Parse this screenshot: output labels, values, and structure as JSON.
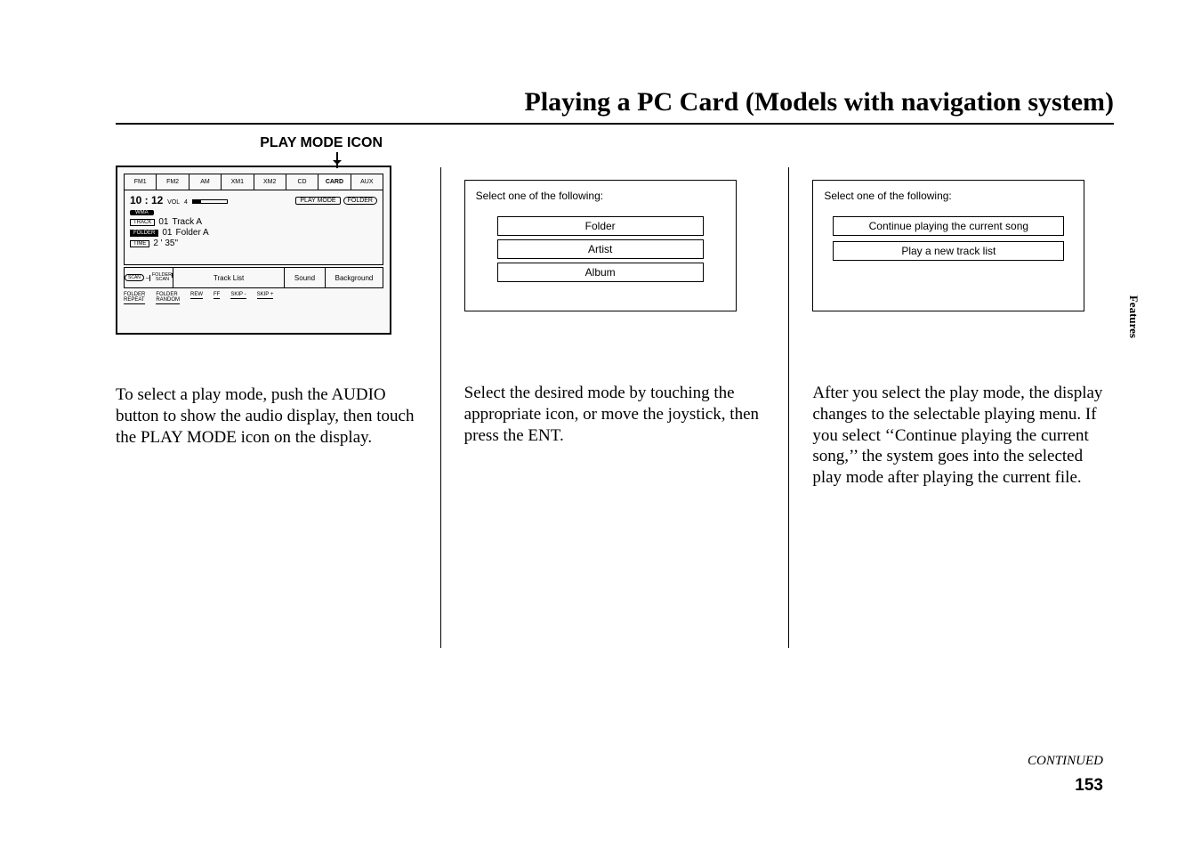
{
  "title": "Playing a PC Card (Models with navigation system)",
  "panel1": {
    "label": "PLAY MODE ICON",
    "tabs": [
      "FM1",
      "FM2",
      "AM",
      "XM1",
      "XM2",
      "CD",
      "CARD",
      "AUX"
    ],
    "active_tab_index": 6,
    "clock": "10 : 12",
    "vol_label": "VOL",
    "vol_value": "4",
    "play_mode_badge": "PLAY MODE",
    "folder_badge": "FOLDER",
    "codec": "WMA",
    "track_chip": "TRACK",
    "track_no": "01",
    "track_name": "Track A",
    "folder_chip": "FOLDER",
    "folder_no": "01",
    "folder_name": "Folder A",
    "time_chip": "TIME",
    "elapsed": "2 ' 35\"",
    "scan_label": "SCAN",
    "scan_sub_top": "FOLDER",
    "scan_sub_bot": "SCAN",
    "track_list": "Track  List",
    "sound": "Sound",
    "background": "Background",
    "folder_repeat_top": "FOLDER",
    "folder_repeat_bot": "REPEAT",
    "folder_random_top": "FOLDER",
    "folder_random_bot": "RANDOM",
    "rew": "REW",
    "ff": "FF",
    "skip_minus": "SKIP -",
    "skip_plus": "SKIP +"
  },
  "panel2": {
    "prompt": "Select one of the following:",
    "options": [
      "Folder",
      "Artist",
      "Album"
    ]
  },
  "panel3": {
    "prompt": "Select one of the following:",
    "options": [
      "Continue playing the current song",
      "Play a new track list"
    ]
  },
  "body1": "To select a play mode, push the AUDIO button to show the audio display, then touch the PLAY MODE icon on the display.",
  "body2": "Select the desired mode by touching the appropriate icon, or move the joystick, then press the ENT.",
  "body3": "After you select the play mode, the display changes to the selectable playing menu. If you select ‘‘Continue playing the current song,’’ the system goes into the selected play mode after playing the current file.",
  "side_tab": "Features",
  "continued": "CONTINUED",
  "page_number": "153"
}
